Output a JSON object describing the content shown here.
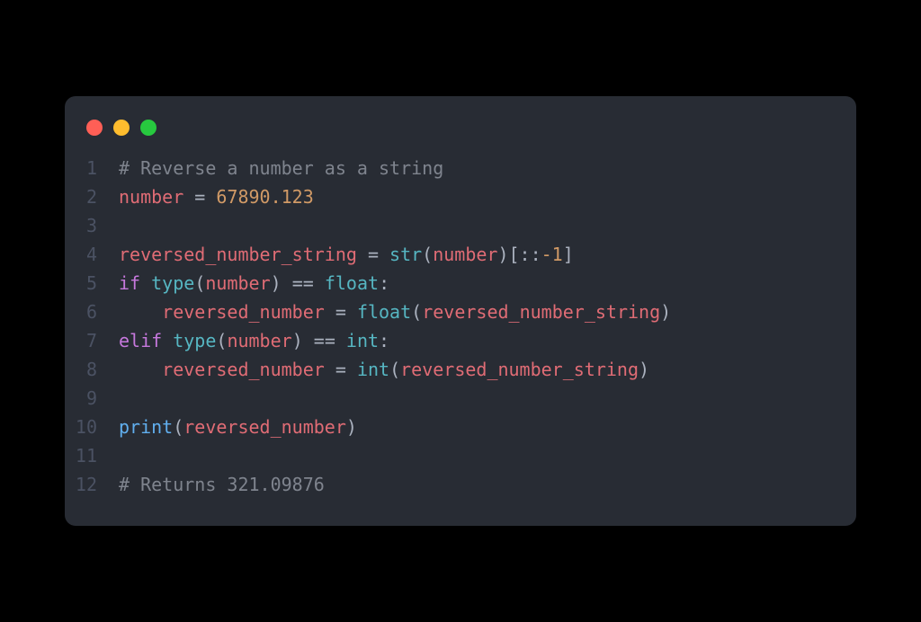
{
  "editor": {
    "theme": "one-dark",
    "traffic_lights": [
      "red",
      "yellow",
      "green"
    ],
    "lines": [
      {
        "n": 1,
        "tokens": [
          {
            "t": "# Reverse a number as a string",
            "c": "comment"
          }
        ]
      },
      {
        "n": 2,
        "tokens": [
          {
            "t": "number",
            "c": "ident"
          },
          {
            "t": " ",
            "c": "default"
          },
          {
            "t": "=",
            "c": "assign"
          },
          {
            "t": " ",
            "c": "default"
          },
          {
            "t": "67890.123",
            "c": "num"
          }
        ]
      },
      {
        "n": 3,
        "tokens": []
      },
      {
        "n": 4,
        "tokens": [
          {
            "t": "reversed_number_string",
            "c": "ident"
          },
          {
            "t": " ",
            "c": "default"
          },
          {
            "t": "=",
            "c": "assign"
          },
          {
            "t": " ",
            "c": "default"
          },
          {
            "t": "str",
            "c": "builtin"
          },
          {
            "t": "(",
            "c": "punct"
          },
          {
            "t": "number",
            "c": "ident"
          },
          {
            "t": ")[::",
            "c": "punct"
          },
          {
            "t": "-1",
            "c": "num"
          },
          {
            "t": "]",
            "c": "punct"
          }
        ]
      },
      {
        "n": 5,
        "tokens": [
          {
            "t": "if",
            "c": "keyword"
          },
          {
            "t": " ",
            "c": "default"
          },
          {
            "t": "type",
            "c": "builtin"
          },
          {
            "t": "(",
            "c": "punct"
          },
          {
            "t": "number",
            "c": "ident"
          },
          {
            "t": ") ",
            "c": "punct"
          },
          {
            "t": "==",
            "c": "op"
          },
          {
            "t": " ",
            "c": "default"
          },
          {
            "t": "float",
            "c": "builtin"
          },
          {
            "t": ":",
            "c": "punct"
          }
        ]
      },
      {
        "n": 6,
        "tokens": [
          {
            "t": "    ",
            "c": "default"
          },
          {
            "t": "reversed_number",
            "c": "ident"
          },
          {
            "t": " ",
            "c": "default"
          },
          {
            "t": "=",
            "c": "assign"
          },
          {
            "t": " ",
            "c": "default"
          },
          {
            "t": "float",
            "c": "builtin"
          },
          {
            "t": "(",
            "c": "punct"
          },
          {
            "t": "reversed_number_string",
            "c": "ident"
          },
          {
            "t": ")",
            "c": "punct"
          }
        ]
      },
      {
        "n": 7,
        "tokens": [
          {
            "t": "elif",
            "c": "keyword"
          },
          {
            "t": " ",
            "c": "default"
          },
          {
            "t": "type",
            "c": "builtin"
          },
          {
            "t": "(",
            "c": "punct"
          },
          {
            "t": "number",
            "c": "ident"
          },
          {
            "t": ") ",
            "c": "punct"
          },
          {
            "t": "==",
            "c": "op"
          },
          {
            "t": " ",
            "c": "default"
          },
          {
            "t": "int",
            "c": "builtin"
          },
          {
            "t": ":",
            "c": "punct"
          }
        ]
      },
      {
        "n": 8,
        "tokens": [
          {
            "t": "    ",
            "c": "default"
          },
          {
            "t": "reversed_number",
            "c": "ident"
          },
          {
            "t": " ",
            "c": "default"
          },
          {
            "t": "=",
            "c": "assign"
          },
          {
            "t": " ",
            "c": "default"
          },
          {
            "t": "int",
            "c": "builtin"
          },
          {
            "t": "(",
            "c": "punct"
          },
          {
            "t": "reversed_number_string",
            "c": "ident"
          },
          {
            "t": ")",
            "c": "punct"
          }
        ]
      },
      {
        "n": 9,
        "tokens": []
      },
      {
        "n": 10,
        "tokens": [
          {
            "t": "print",
            "c": "func"
          },
          {
            "t": "(",
            "c": "punct"
          },
          {
            "t": "reversed_number",
            "c": "ident"
          },
          {
            "t": ")",
            "c": "punct"
          }
        ]
      },
      {
        "n": 11,
        "tokens": []
      },
      {
        "n": 12,
        "tokens": [
          {
            "t": "# Returns 321.09876",
            "c": "comment"
          }
        ]
      }
    ]
  }
}
